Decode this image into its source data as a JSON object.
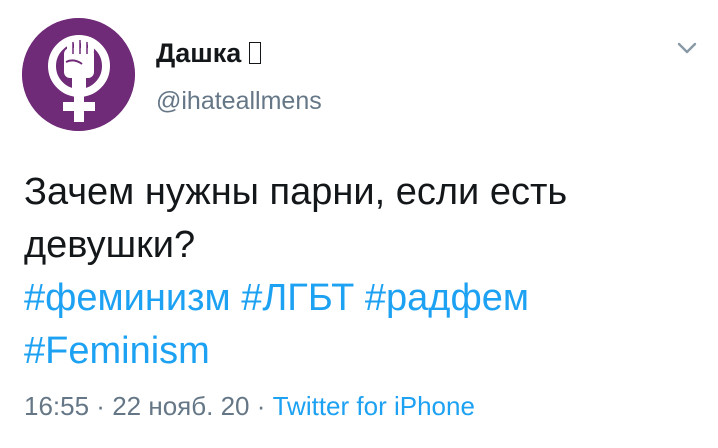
{
  "author": {
    "display_name": "Дашка",
    "handle": "@ihateallmens",
    "avatar_icon": "feminist-fist-venus-icon",
    "avatar_color": "#6f2a78"
  },
  "menu": {
    "icon": "chevron-down-icon"
  },
  "tweet": {
    "text_line1": "Зачем нужны парни, если есть",
    "text_line2": "девушки?",
    "hashtags": [
      "#феминизм",
      "#ЛГБТ",
      "#радфем",
      "#Feminism"
    ]
  },
  "meta": {
    "time": "16:55",
    "separator1": " · ",
    "date": "22 нояб. 20",
    "separator2": " · ",
    "source": "Twitter for iPhone"
  },
  "colors": {
    "link": "#1da1f2",
    "secondary": "#657786",
    "text": "#14171a"
  }
}
